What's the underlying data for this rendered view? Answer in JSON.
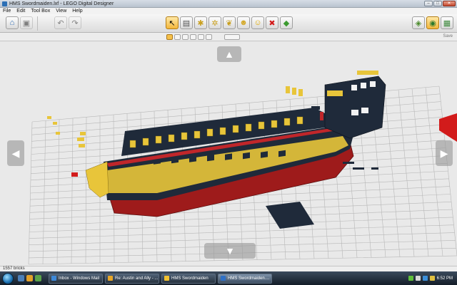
{
  "window": {
    "title": "HMS Swordmaiden.lxf - LEGO Digital Designer",
    "minimize": "–",
    "maximize": "□",
    "close": "✕"
  },
  "menu": [
    "File",
    "Edit",
    "Tool Box",
    "View",
    "Help"
  ],
  "toolbar": {
    "home_icon": "⌂",
    "save_icon": "▣",
    "undo_icon": "↶",
    "redo_icon": "↷",
    "select_icon": "↖",
    "clone_icon": "▤",
    "hinge_icon": "✱",
    "hinge_align_icon": "✲",
    "flex_icon": "❦",
    "paint_icon": "☻",
    "decorate_icon": "☺",
    "delete_icon": "✖",
    "hide_icon": "◆",
    "mode_build_icon": "◈",
    "mode_view_icon": "◉",
    "mode_instructions_icon": "▦"
  },
  "subtoolbar": {
    "save_label": "Save"
  },
  "status": {
    "brick_count": "1557 bricks"
  },
  "taskbar": {
    "items": [
      {
        "label": "Inbox - Windows Mail",
        "color": "#3d88d8"
      },
      {
        "label": "Re: Austin and Ally - ...",
        "color": "#e8a628"
      },
      {
        "label": "HMS Swordmaiden",
        "color": "#f2c230"
      },
      {
        "label": "HMS Swordmaiden....",
        "color": "#2f6fc4"
      }
    ],
    "clock": "6:52 PM"
  },
  "colors": {
    "hull_yellow": "#e8c53a",
    "hull_dark": "#1f2a3a",
    "hull_red": "#9e1b1b",
    "grid_line": "#b7b7b7",
    "active_tool": "#f3b63a"
  }
}
